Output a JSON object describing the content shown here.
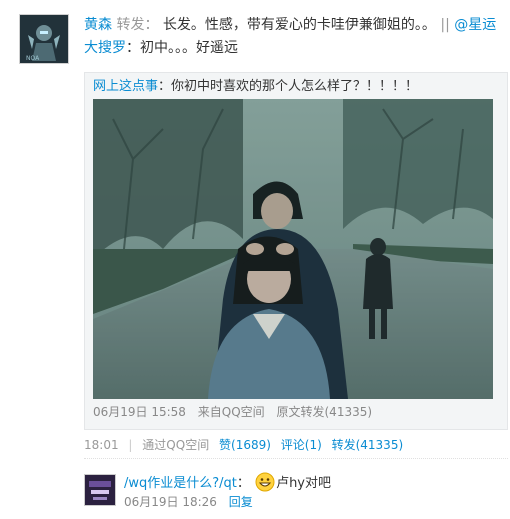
{
  "post": {
    "author": "黄森",
    "repost_label": "转发：",
    "text": "长发。性感，带有爱心的卡哇伊兼御姐的。。",
    "divider": "||",
    "mention": "@星运大搜罗",
    "mention_text": "：初中。。。好遥远"
  },
  "quote": {
    "source": "网上这点事",
    "text": "：你初中时喜欢的那个人怎么样了？！！！！",
    "time": "06月19日 15:58",
    "from": "来自QQ空间",
    "repost_count": "原文转发(41335)"
  },
  "actions": {
    "time": "18:01",
    "source": "通过QQ空间",
    "like": "赞(1689)",
    "comment": "评论(1)",
    "repost": "转发(41335)"
  },
  "comment": {
    "author": "/wq作业是什么?/qt",
    "colon": "：",
    "text": "卢hy对吧",
    "time": "06月19日 18:26",
    "reply": "回复"
  },
  "colors": {
    "link": "#0a8cd2",
    "quote_bg": "#f3f5f6"
  }
}
